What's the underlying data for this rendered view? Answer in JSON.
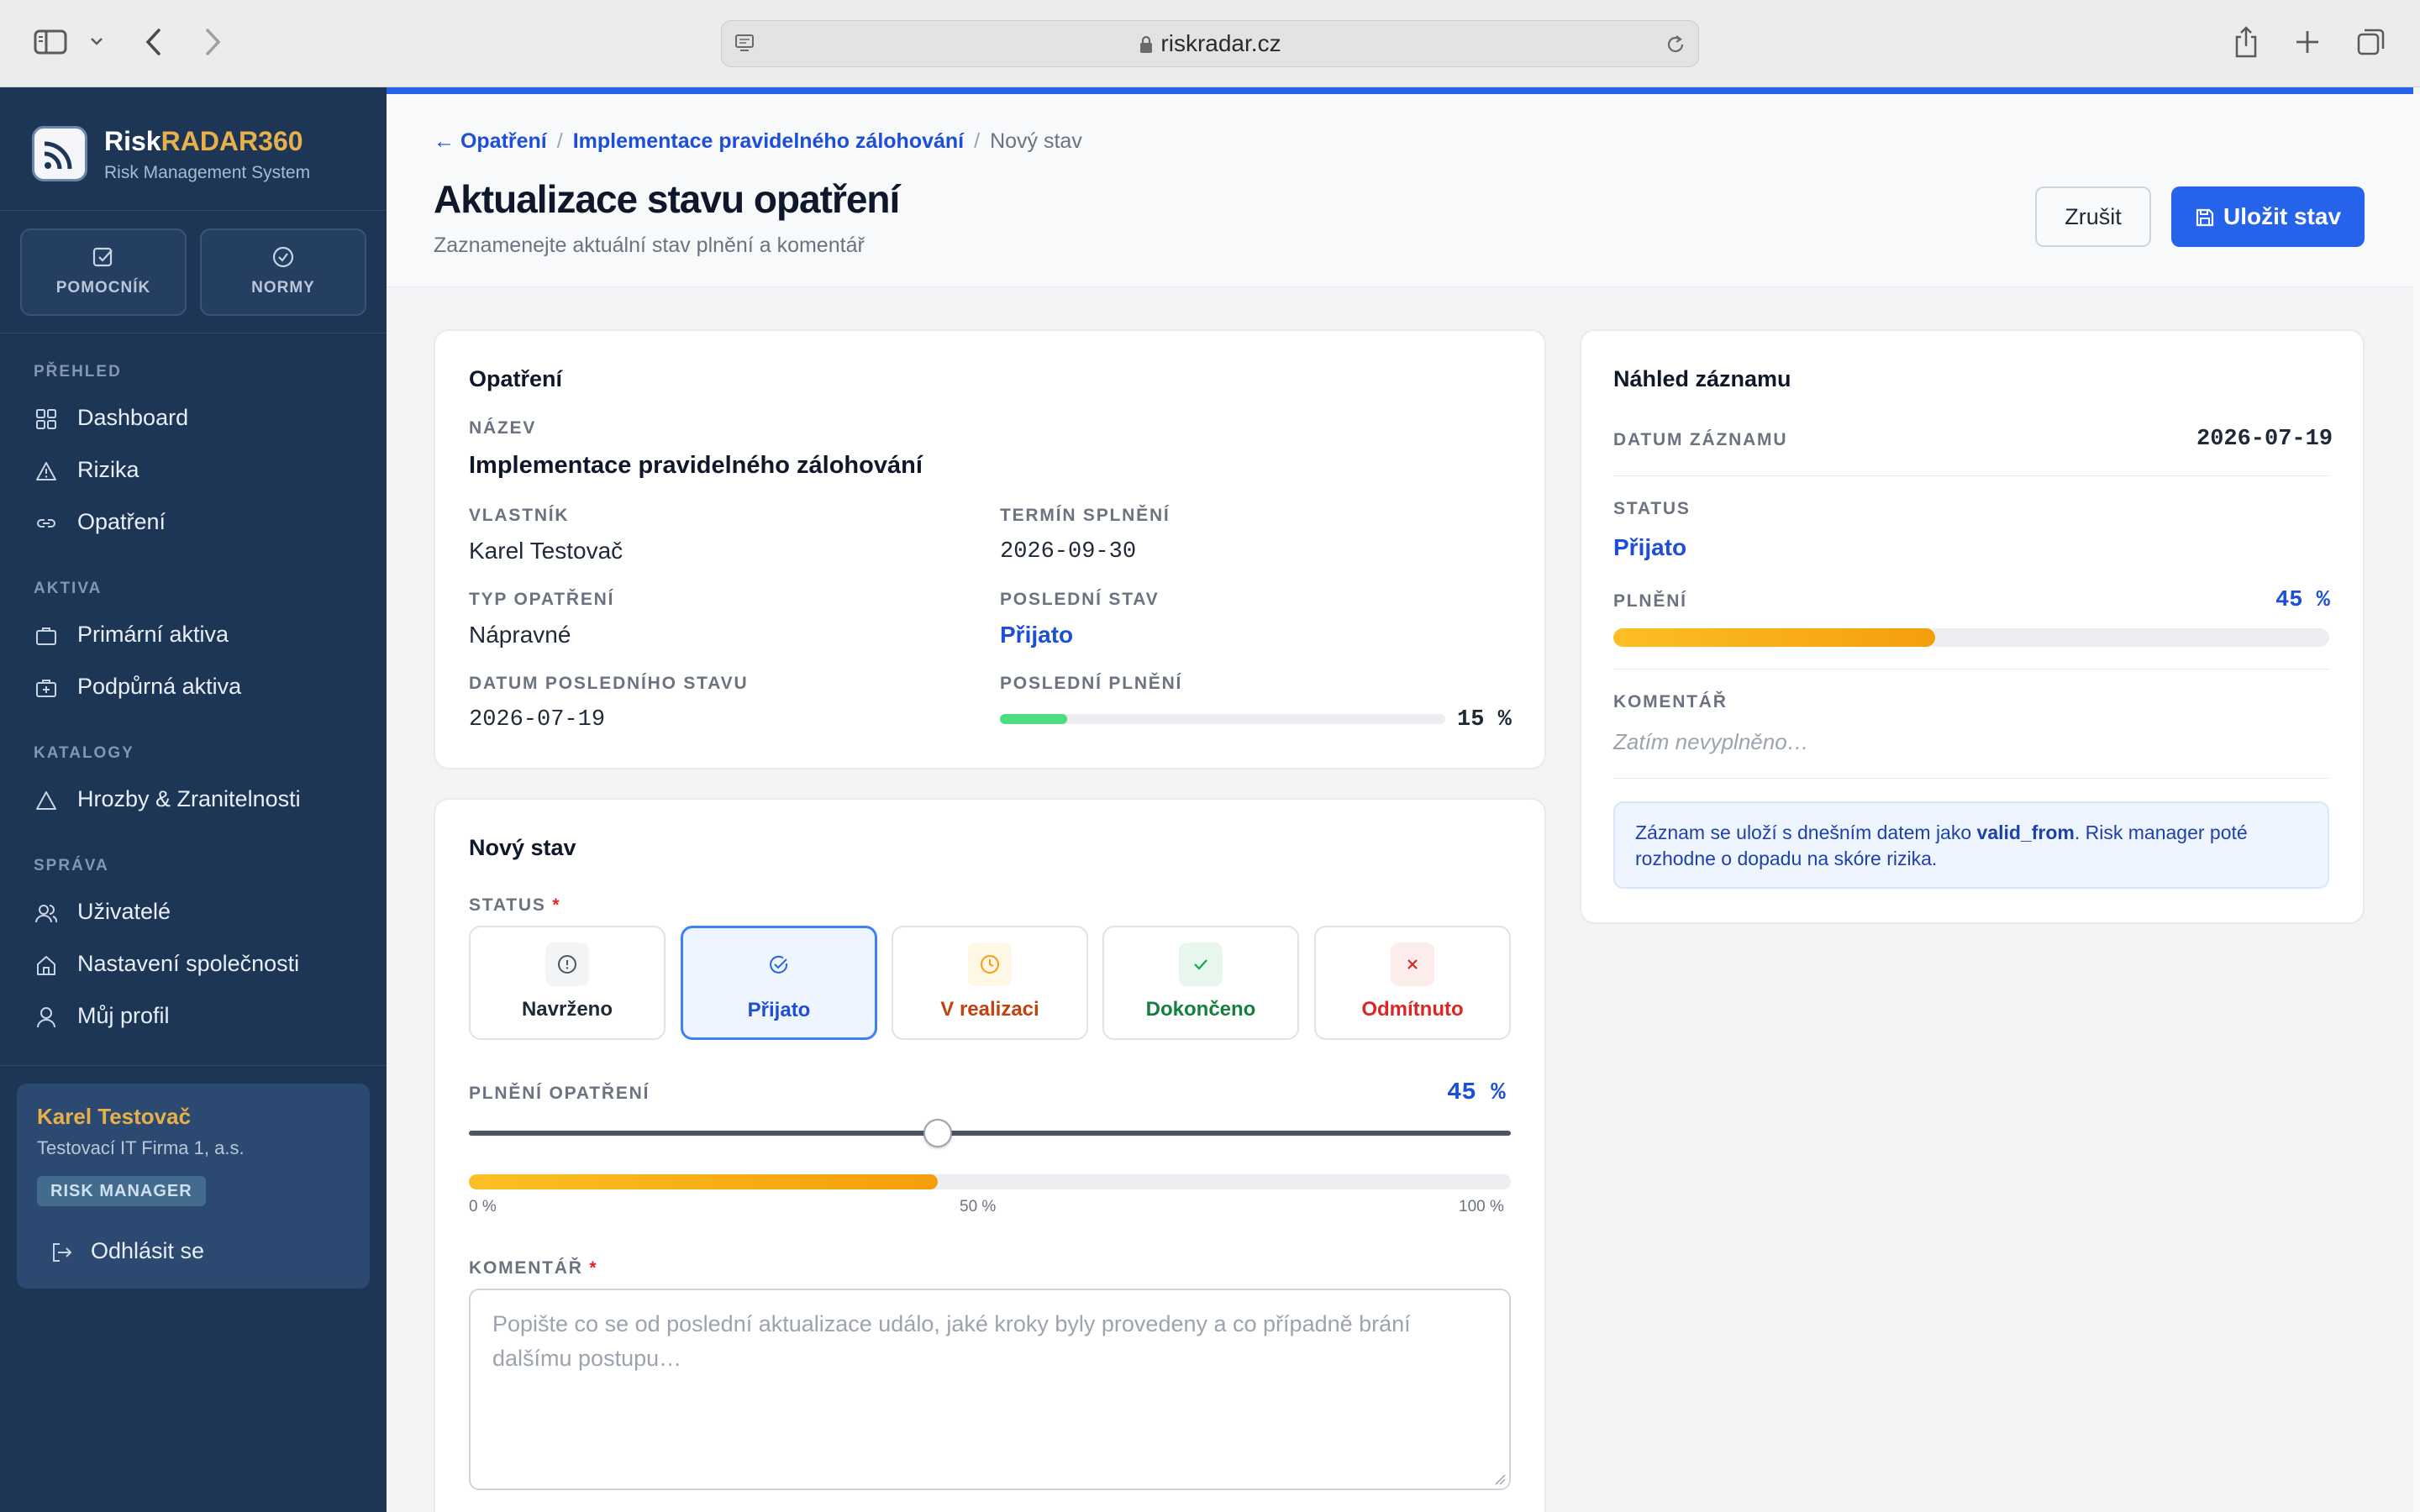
{
  "browser": {
    "url": "riskradar.cz"
  },
  "sidebar": {
    "brand_a": "Risk",
    "brand_b": "RADAR360",
    "brand_sub": "Risk Management System",
    "quick": [
      {
        "label": "POMOCNÍK"
      },
      {
        "label": "NORMY"
      }
    ],
    "sections": [
      {
        "title": "PŘEHLED",
        "items": [
          {
            "label": "Dashboard"
          },
          {
            "label": "Rizika"
          },
          {
            "label": "Opatření"
          }
        ]
      },
      {
        "title": "AKTIVA",
        "items": [
          {
            "label": "Primární aktiva"
          },
          {
            "label": "Podpůrná aktiva"
          }
        ]
      },
      {
        "title": "KATALOGY",
        "items": [
          {
            "label": "Hrozby & Zranitelnosti"
          }
        ]
      },
      {
        "title": "SPRÁVA",
        "items": [
          {
            "label": "Uživatelé"
          },
          {
            "label": "Nastavení společnosti"
          },
          {
            "label": "Můj profil"
          }
        ]
      }
    ],
    "user": {
      "name": "Karel Testovač",
      "company": "Testovací IT Firma 1, a.s.",
      "role": "RISK MANAGER",
      "logout": "Odhlásit se"
    }
  },
  "header": {
    "breadcrumb": {
      "back": "← Opatření",
      "parent": "Implementace pravidelného zálohování",
      "current": "Nový stav"
    },
    "title": "Aktualizace stavu opatření",
    "subtitle": "Zaznamenejte aktuální stav plnění a komentář",
    "cancel": "Zrušit",
    "save": "Uložit stav"
  },
  "measure": {
    "card_title": "Opatření",
    "name_label": "NÁZEV",
    "name": "Implementace pravidelného zálohování",
    "owner_label": "VLASTNÍK",
    "owner": "Karel Testovač",
    "deadline_label": "TERMÍN SPLNĚNÍ",
    "deadline": "2026-09-30",
    "type_label": "TYP OPATŘENÍ",
    "type": "Nápravné",
    "last_status_label": "POSLEDNÍ STAV",
    "last_status": "Přijato",
    "last_date_label": "DATUM POSLEDNÍHO STAVU",
    "last_date": "2026-07-19",
    "last_progress_label": "POSLEDNÍ PLNĚNÍ",
    "last_progress_text": "15 %",
    "last_progress": 15
  },
  "new_state": {
    "card_title": "Nový stav",
    "status_label": "STATUS",
    "required_mark": "*",
    "options": [
      {
        "label": "Navrženo",
        "icon": "info-circle-icon",
        "selected": false
      },
      {
        "label": "Přijato",
        "icon": "check-circle-icon",
        "selected": true
      },
      {
        "label": "V realizaci",
        "icon": "clock-icon",
        "selected": false
      },
      {
        "label": "Dokončeno",
        "icon": "check-icon",
        "selected": false
      },
      {
        "label": "Odmítnuto",
        "icon": "x-icon",
        "selected": false
      }
    ],
    "progress_label": "PLNĚNÍ OPATŘENÍ",
    "progress_text": "45  %",
    "progress": 45,
    "tick_0": "0 %",
    "tick_50": "50 %",
    "tick_100": "100 %",
    "comment_label": "KOMENTÁŘ",
    "comment_placeholder": "Popište co se od poslední aktualizace událo, jaké kroky byly provedeny a co případně brání dalšímu postupu…"
  },
  "preview": {
    "card_title": "Náhled záznamu",
    "date_label": "DATUM ZÁZNAMU",
    "date": "2026-07-19",
    "status_label": "STATUS",
    "status": "Přijato",
    "progress_label": "PLNĚNÍ",
    "progress_text": "45 %",
    "progress": 45,
    "comment_label": "KOMENTÁŘ",
    "comment": "Zatím nevyplněno…",
    "info_a": "Záznam se uloží s dnešním datem jako ",
    "info_b": "valid_from",
    "info_c": ". Risk manager poté rozhodne o dopadu na skóre rizika."
  },
  "colors": {
    "accent": "#2563eb",
    "sidebar": "#1e3656",
    "brand_gold": "#e8b04b",
    "progress_green": "#4ade80",
    "progress_orange": "#f59e0b"
  }
}
